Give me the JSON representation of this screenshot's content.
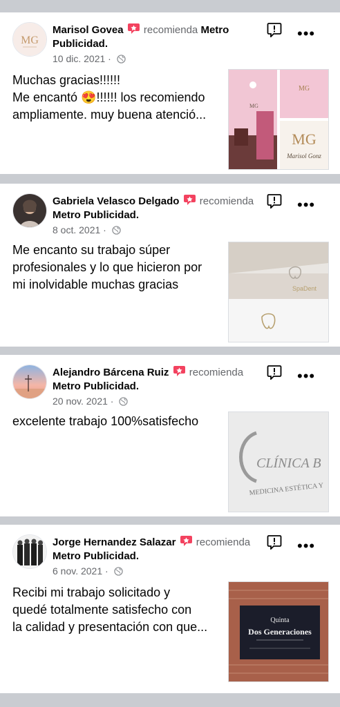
{
  "recommendation_word": "recomienda",
  "page_name": "Metro Publicidad.",
  "reviews": [
    {
      "author": "Marisol Govea",
      "date": "10 dic. 2021",
      "text": [
        "Muchas  gracias!!!!!!",
        "Me encantó 😍!!!!!! los recomiendo",
        "ampliamente. muy buena atenció..."
      ],
      "avatar_text": "MG",
      "photo_text": "Marisol Gonz"
    },
    {
      "author": "Gabriela Velasco Delgado",
      "date": "8 oct. 2021",
      "text": [
        "Me encanto su trabajo súper",
        "profesionales y lo que hicieron por",
        "mi inolvidable muchas gracias"
      ],
      "photo_text": "SpaDent"
    },
    {
      "author": "Alejandro Bárcena Ruiz",
      "date": "20 nov. 2021",
      "text": [
        "excelente trabajo 100%satisfecho"
      ],
      "photo_text": [
        "CLÍNICA B",
        "MEDICINA ESTÉTICA Y"
      ]
    },
    {
      "author": "Jorge Hernandez Salazar",
      "date": "6 nov. 2021",
      "text": [
        "Recibi mi trabajo solicitado y",
        "quedé totalmente satisfecho con",
        "la calidad y presentación con que..."
      ],
      "photo_text": [
        "Quinta",
        "Dos Generaciones"
      ]
    }
  ],
  "colors": {
    "background": "#c9ccd1",
    "card": "#ffffff",
    "recommend_badge": "#f3425f",
    "secondary_text": "#65676b"
  }
}
